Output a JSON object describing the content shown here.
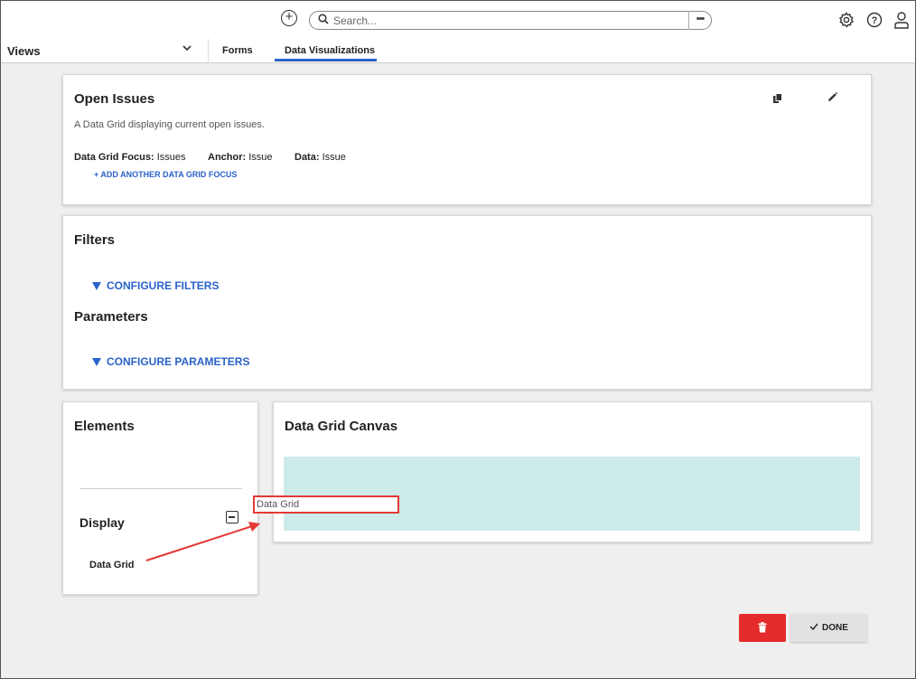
{
  "header": {
    "search_placeholder": "Search...",
    "more_label": "•••"
  },
  "nav": {
    "views_label": "Views",
    "tabs": [
      {
        "label": "Forms"
      },
      {
        "label": "Data Visualizations",
        "active": true
      }
    ]
  },
  "overview": {
    "title": "Open Issues",
    "description": "A Data Grid displaying current open issues.",
    "focus_label": "Data Grid Focus:",
    "focus_value": "Issues",
    "anchor_label": "Anchor:",
    "anchor_value": "Issue",
    "data_label": "Data:",
    "data_value": "Issue",
    "add_focus_label": "+ ADD ANOTHER DATA GRID FOCUS"
  },
  "filters": {
    "title": "Filters",
    "configure_filters_label": "CONFIGURE FILTERS",
    "parameters_title": "Parameters",
    "configure_parameters_label": "CONFIGURE PARAMETERS"
  },
  "elements": {
    "title": "Elements",
    "display_title": "Display",
    "items": [
      {
        "label": "Data Grid"
      }
    ]
  },
  "canvas": {
    "title": "Data Grid Canvas",
    "drop_label": "Data Grid"
  },
  "actions": {
    "done_label": "DONE"
  },
  "colors": {
    "accent": "#2a62c9",
    "delete": "#e52b2b",
    "canvas_bg": "#cdece9",
    "annotation": "#e53935"
  }
}
